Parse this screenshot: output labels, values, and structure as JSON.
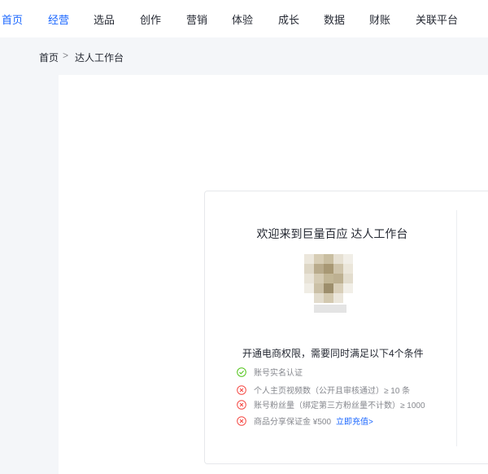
{
  "nav": {
    "items": [
      {
        "label": "首页",
        "active": true
      },
      {
        "label": "经营",
        "active": true
      },
      {
        "label": "选品",
        "active": false
      },
      {
        "label": "创作",
        "active": false
      },
      {
        "label": "营销",
        "active": false
      },
      {
        "label": "体验",
        "active": false
      },
      {
        "label": "成长",
        "active": false
      },
      {
        "label": "数据",
        "active": false
      },
      {
        "label": "财账",
        "active": false
      },
      {
        "label": "关联平台",
        "active": false
      }
    ]
  },
  "breadcrumb": {
    "home": "首页",
    "separator": ">",
    "current": "达人工作台"
  },
  "card": {
    "welcome": "欢迎来到巨量百应 达人工作台",
    "conditions_title": "开通电商权限，需要同时满足以下4个条件",
    "conditions": [
      {
        "text": "账号实名认证",
        "status": "met",
        "icon": "check-circle-icon"
      },
      {
        "text": "个人主页视频数（公开且审核通过）≥ 10 条",
        "status": "unmet",
        "icon": "x-circle-icon"
      },
      {
        "text": "账号粉丝量（绑定第三方粉丝量不计数）≥ 1000",
        "status": "unmet",
        "icon": "x-circle-icon"
      },
      {
        "text": "商品分享保证金 ¥500",
        "status": "unmet",
        "icon": "x-circle-icon",
        "link": "立即充值>"
      }
    ]
  },
  "colors": {
    "accent": "#1966ff",
    "met": "#52c41a",
    "unmet": "#f54a45"
  }
}
